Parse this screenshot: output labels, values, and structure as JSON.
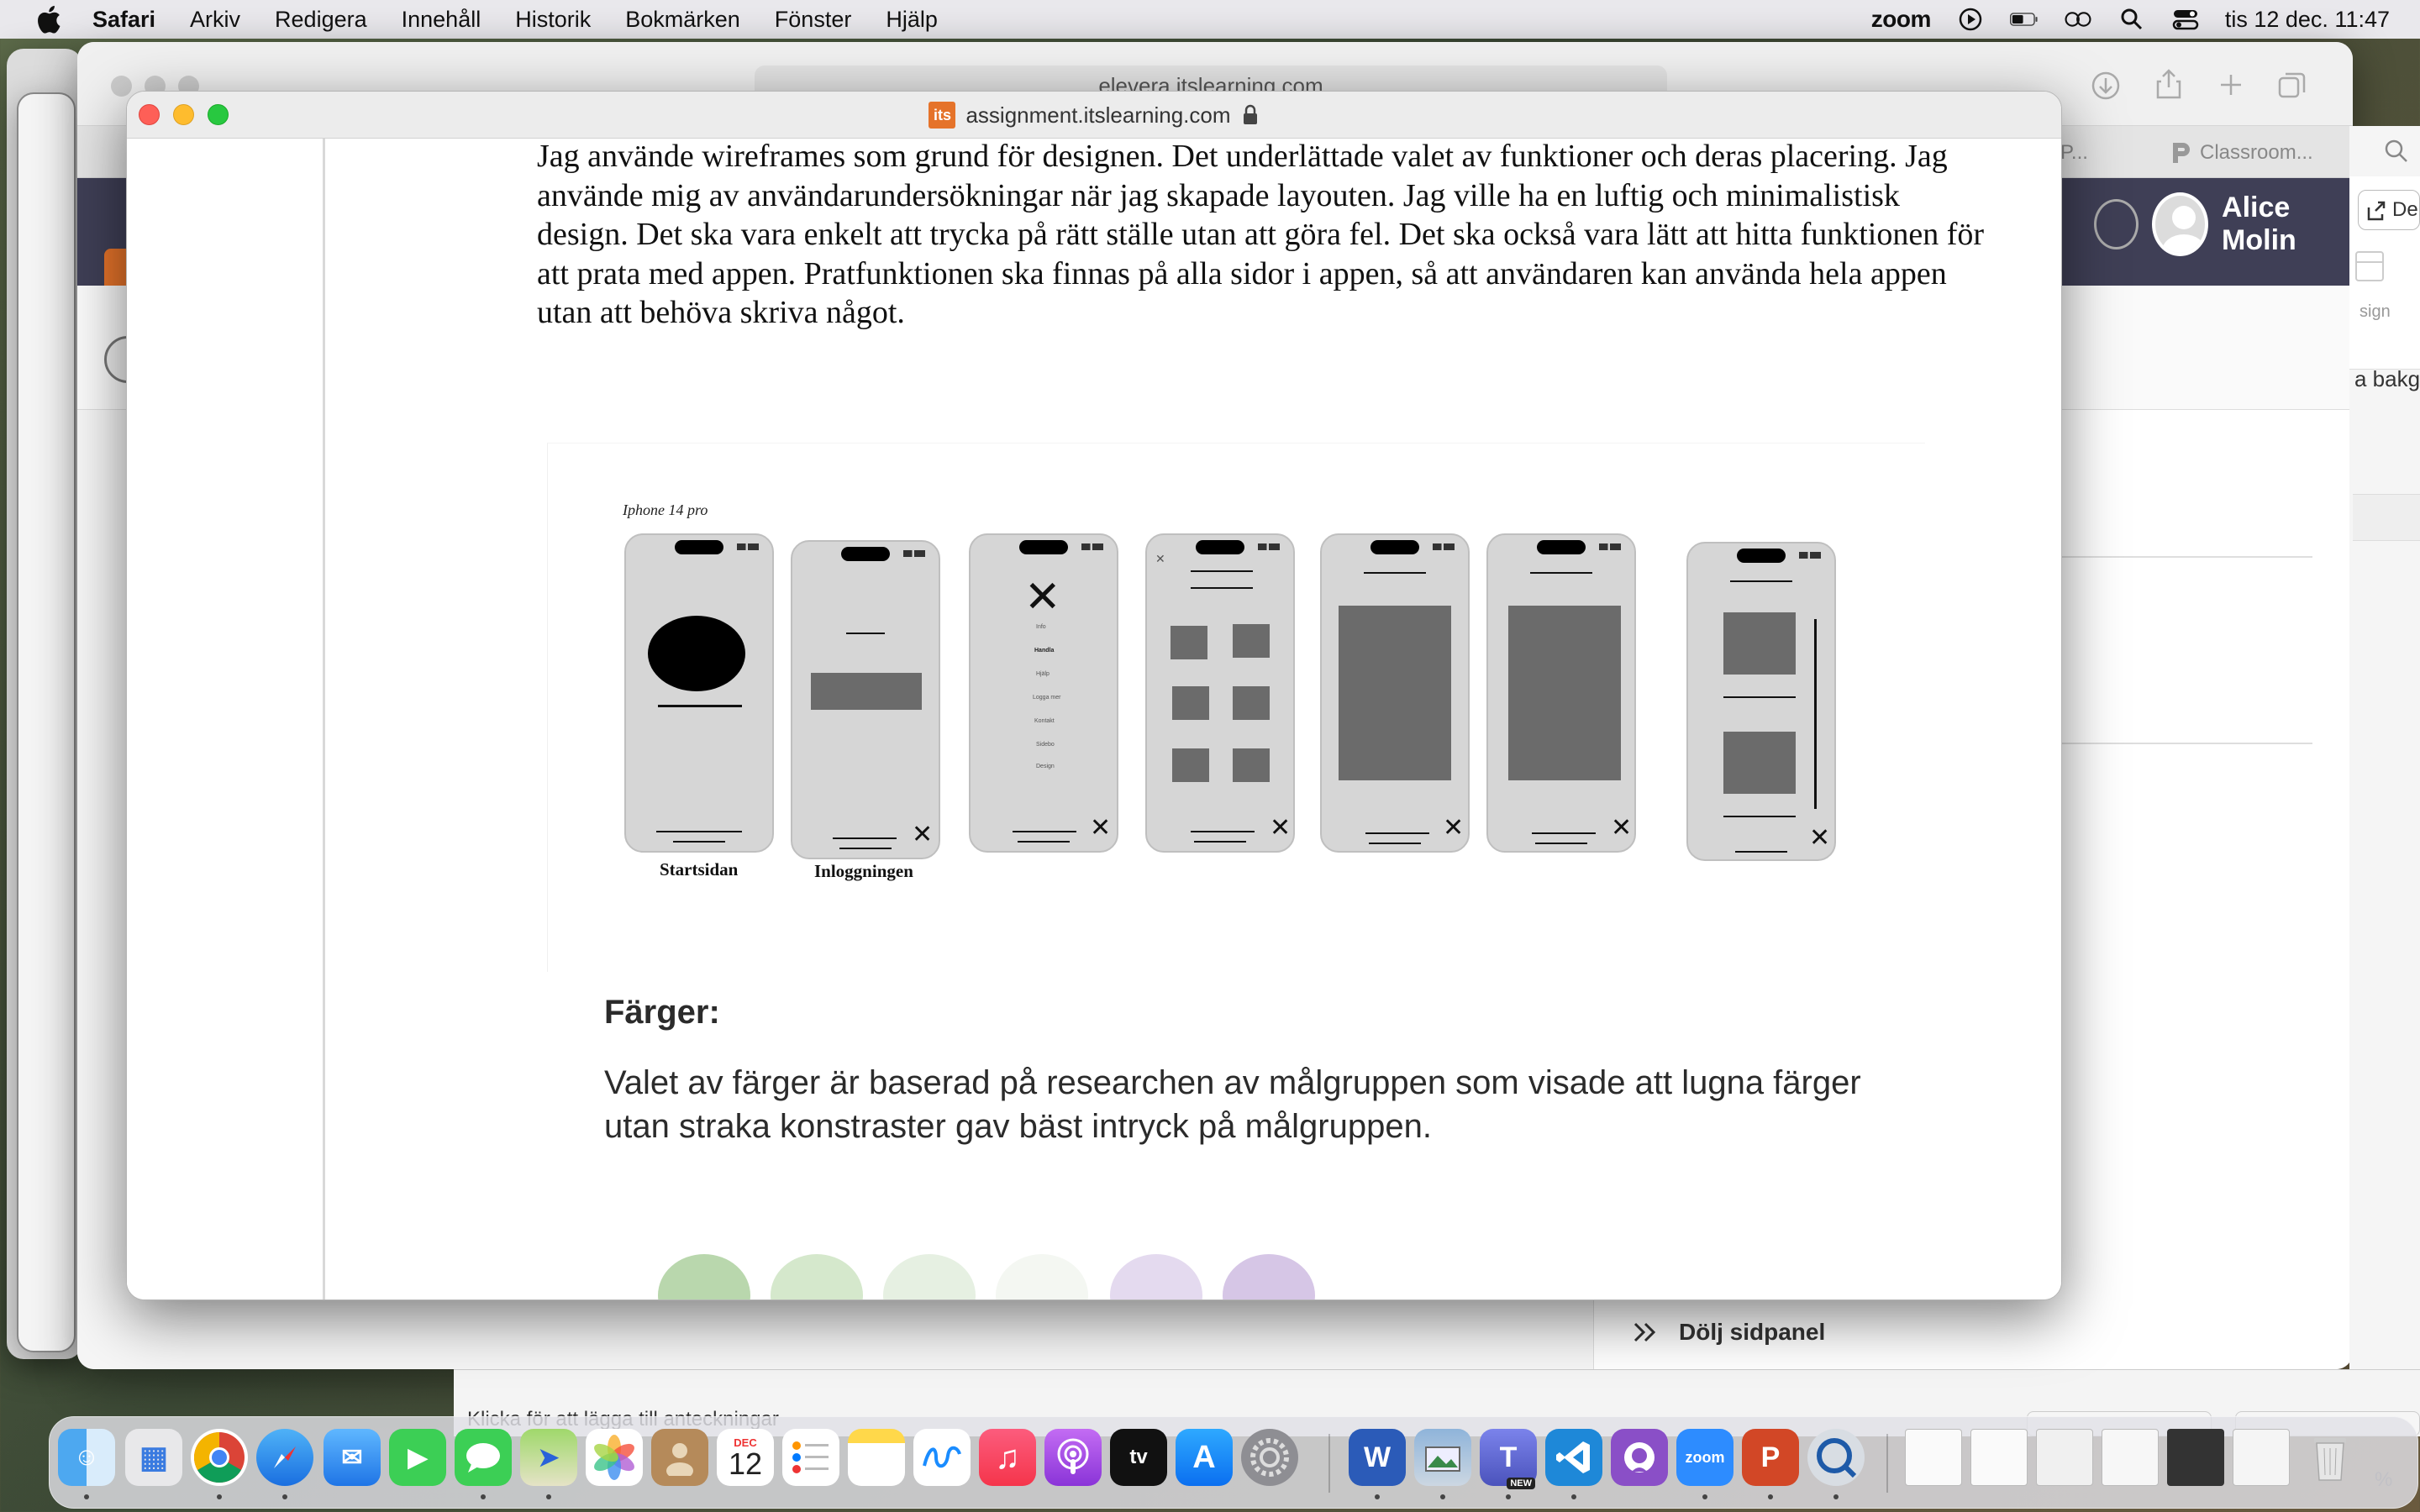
{
  "menubar": {
    "app": "Safari",
    "items": [
      "Arkiv",
      "Redigera",
      "Innehåll",
      "Historik",
      "Bokmärken",
      "Fönster",
      "Hjälp"
    ],
    "zoom": "zoom",
    "clock": "tis 12 dec. 11:47"
  },
  "back_window": {
    "url": "elevera.itslearning.com",
    "tabs": [
      "P...",
      "Classroom..."
    ],
    "user_name": "Alice Molin",
    "hide_panel": "Dölj sidpanel",
    "notes_placeholder": "Klicka för att lägga till anteckningar",
    "right_strip": {
      "share": "De",
      "assign": "sign",
      "bg": "a bakgr",
      "zoom_pct": "%"
    }
  },
  "front_window": {
    "url": "assignment.itslearning.com",
    "logo": "its",
    "paragraph": "Jag använde wireframes som grund för designen. Det underlättade valet av funktioner och deras placering. Jag använde mig av användarundersökningar när jag skapade layouten. Jag ville ha en luftig och minimalistisk design. Det ska vara enkelt att trycka på rätt ställe utan att göra fel. Det ska också vara lätt att hitta funktionen för att prata med appen. Pratfunktionen ska finnas på alla sidor i appen, så att användaren kan använda hela appen utan att behöva skriva något.",
    "wireframe_label": "Iphone 14 pro",
    "captions": [
      "Startsidan",
      "Inloggningen"
    ],
    "menu_words": [
      "Info",
      "Handla",
      "Hjälp",
      "Logga mer",
      "Kontakt",
      "Sidebo",
      "Design"
    ],
    "colors_heading": "Färger:",
    "colors_paragraph": "Valet av färger är baserad på researchen av målgruppen som visade att lugna färger utan straka konstraster gav bäst intryck på målgruppen.",
    "swatches": [
      "#b9d7ad",
      "#d5e8cc",
      "#e6f0e2",
      "#f4f7f2",
      "#e4daef",
      "#d6c6e6"
    ]
  },
  "dock": {
    "calendar_month": "DEC",
    "calendar_day": "12",
    "teams_badge": "NEW",
    "zoom_label": "zoom"
  }
}
